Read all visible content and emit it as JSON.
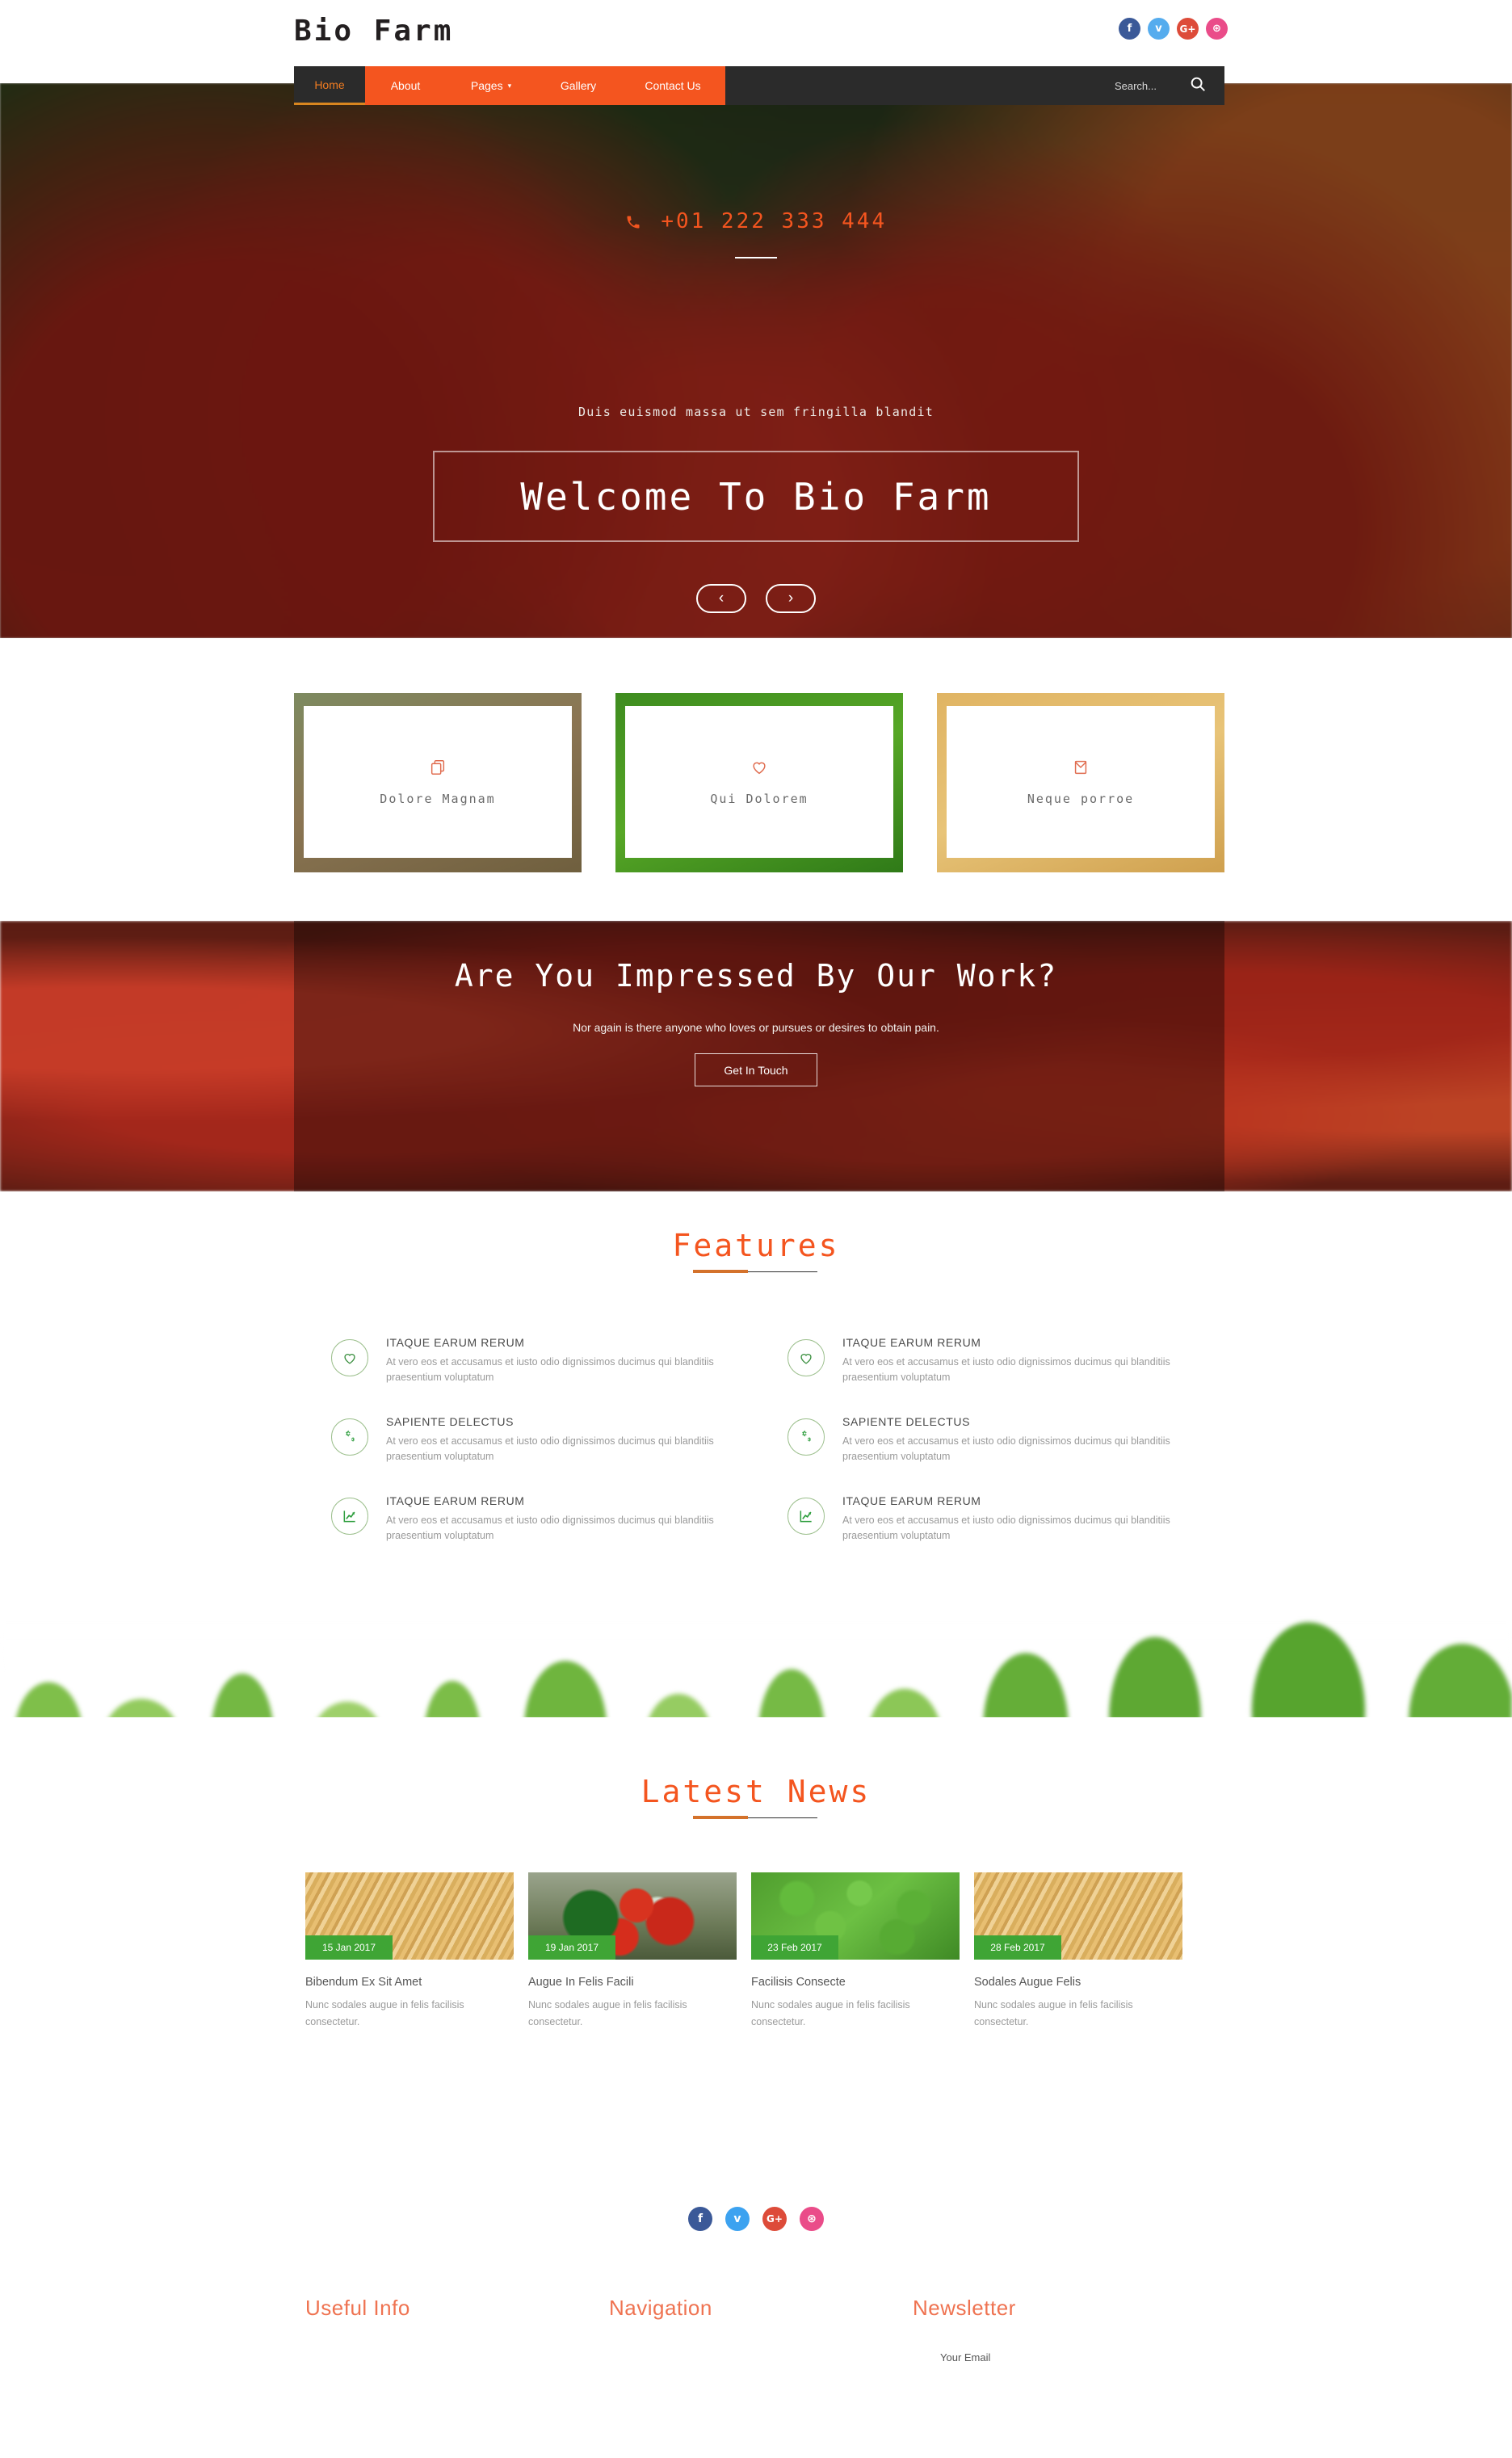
{
  "header": {
    "brand": "Bio Farm",
    "social": [
      {
        "name": "facebook-icon",
        "glyph": "f",
        "color": "#3b5998"
      },
      {
        "name": "twitter-icon",
        "glyph": "ᴠ",
        "color": "#55acee"
      },
      {
        "name": "google-plus-icon",
        "glyph": "G+",
        "color": "#dd4b39"
      },
      {
        "name": "dribbble-icon",
        "glyph": "⊛",
        "color": "#ea4c89"
      }
    ]
  },
  "nav": {
    "items": [
      {
        "label": "Home",
        "active": true,
        "caret": false,
        "width": 88
      },
      {
        "label": "About",
        "active": false,
        "caret": false,
        "width": 100
      },
      {
        "label": "Pages",
        "active": false,
        "caret": true,
        "width": 112
      },
      {
        "label": "Gallery",
        "active": false,
        "caret": false,
        "width": 104
      },
      {
        "label": "Contact Us",
        "active": false,
        "caret": false,
        "width": 130
      }
    ],
    "search_placeholder": "Search...",
    "search_value": "",
    "search_icon": "search-icon"
  },
  "hero": {
    "phone": "+01 222 333 444",
    "phone_icon": "phone-icon",
    "subtitle": "Duis euismod massa ut sem fringilla blandit",
    "title": "Welcome To Bio Farm",
    "prev_label": "‹",
    "next_label": "›"
  },
  "cards": [
    {
      "label": "Dolore Magnam",
      "icon": "copy-icon"
    },
    {
      "label": "Qui Dolorem",
      "icon": "heart-icon"
    },
    {
      "label": "Neque porroe",
      "icon": "envelope-icon"
    }
  ],
  "cta": {
    "title": "Are You Impressed By Our Work?",
    "subtitle": "Nor again is there anyone who loves or pursues or desires to obtain pain.",
    "button": "Get In Touch"
  },
  "features": {
    "heading": "Features",
    "left": [
      {
        "icon": "heart-icon",
        "title": "ITAQUE EARUM RERUM",
        "text": "At vero eos et accusamus et iusto odio dignissimos ducimus qui blanditiis praesentium voluptatum"
      },
      {
        "icon": "gears-icon",
        "title": "SAPIENTE DELECTUS",
        "text": "At vero eos et accusamus et iusto odio dignissimos ducimus qui blanditiis praesentium voluptatum"
      },
      {
        "icon": "chart-line-icon",
        "title": "ITAQUE EARUM RERUM",
        "text": "At vero eos et accusamus et iusto odio dignissimos ducimus qui blanditiis praesentium voluptatum"
      }
    ],
    "right": [
      {
        "icon": "heart-icon",
        "title": "ITAQUE EARUM RERUM",
        "text": "At vero eos et accusamus et iusto odio dignissimos ducimus qui blanditiis praesentium voluptatum"
      },
      {
        "icon": "gears-icon",
        "title": "SAPIENTE DELECTUS",
        "text": "At vero eos et accusamus et iusto odio dignissimos ducimus qui blanditiis praesentium voluptatum"
      },
      {
        "icon": "chart-line-icon",
        "title": "ITAQUE EARUM RERUM",
        "text": "At vero eos et accusamus et iusto odio dignissimos ducimus qui blanditiis praesentium voluptatum"
      }
    ]
  },
  "news": {
    "heading": "Latest News",
    "items": [
      {
        "date": "15 Jan 2017",
        "title": "Bibendum Ex Sit Amet",
        "text": "Nunc sodales augue in felis facilisis consectetur.",
        "thumb": "wheat"
      },
      {
        "date": "19 Jan 2017",
        "title": "Augue In Felis Facili",
        "text": "Nunc sodales augue in felis facilisis consectetur.",
        "thumb": "veg"
      },
      {
        "date": "23 Feb 2017",
        "title": "Facilisis Consecte",
        "text": "Nunc sodales augue in felis facilisis consectetur.",
        "thumb": "peas"
      },
      {
        "date": "28 Feb 2017",
        "title": "Sodales Augue Felis",
        "text": "Nunc sodales augue in felis facilisis consectetur.",
        "thumb": "wheat"
      }
    ]
  },
  "footer": {
    "social": [
      {
        "name": "facebook-icon",
        "glyph": "f",
        "color": "#3b5998"
      },
      {
        "name": "twitter-icon",
        "glyph": "ᴠ",
        "color": "#3ca2f0"
      },
      {
        "name": "google-plus-icon",
        "glyph": "G+",
        "color": "#dd4b39"
      },
      {
        "name": "dribbble-icon",
        "glyph": "⊛",
        "color": "#ea4c89"
      }
    ],
    "columns": [
      {
        "heading": "Useful Info"
      },
      {
        "heading": "Navigation"
      },
      {
        "heading": "Newsletter"
      }
    ],
    "newsletter_placeholder": "Your Email",
    "newsletter_value": ""
  },
  "colors": {
    "accent_orange": "#f4551f",
    "nav_dark": "#2b2b2b",
    "green": "#3fa535",
    "footer_heading": "#ef7351"
  }
}
